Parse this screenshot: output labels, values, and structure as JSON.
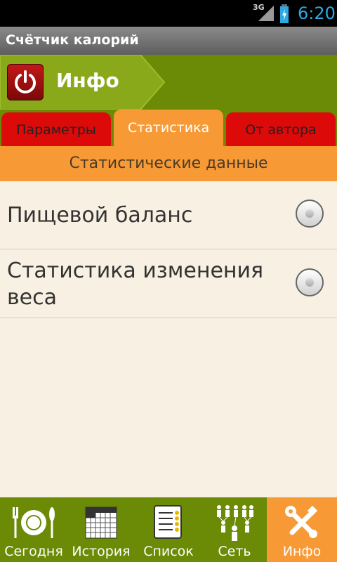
{
  "status_bar": {
    "network": "3G",
    "time": "6:20"
  },
  "app_title": "Счётчик калорий",
  "header": {
    "title": "Инфо",
    "icon": "power-icon"
  },
  "tabs": [
    {
      "label": "Параметры",
      "active": false
    },
    {
      "label": "Статистика",
      "active": true
    },
    {
      "label": "От автора",
      "active": false
    }
  ],
  "section_title": "Статистические данные",
  "options": [
    {
      "label": "Пищевой баланс",
      "selected": false
    },
    {
      "label_line1": "Статистика изменения",
      "label_line2": "веса",
      "selected": false
    }
  ],
  "bottom_nav": [
    {
      "label": "Сегодня",
      "icon": "plate-cutlery-icon",
      "active": false
    },
    {
      "label": "История",
      "icon": "calendar-icon",
      "active": false
    },
    {
      "label": "Список",
      "icon": "list-icon",
      "active": false
    },
    {
      "label": "Сеть",
      "icon": "people-network-icon",
      "active": false
    },
    {
      "label": "Инфо",
      "icon": "tools-icon",
      "active": true
    }
  ],
  "colors": {
    "green": "#6b8a06",
    "orange": "#f79a35",
    "red": "#dd0a0a",
    "background": "#f8f0e2"
  }
}
